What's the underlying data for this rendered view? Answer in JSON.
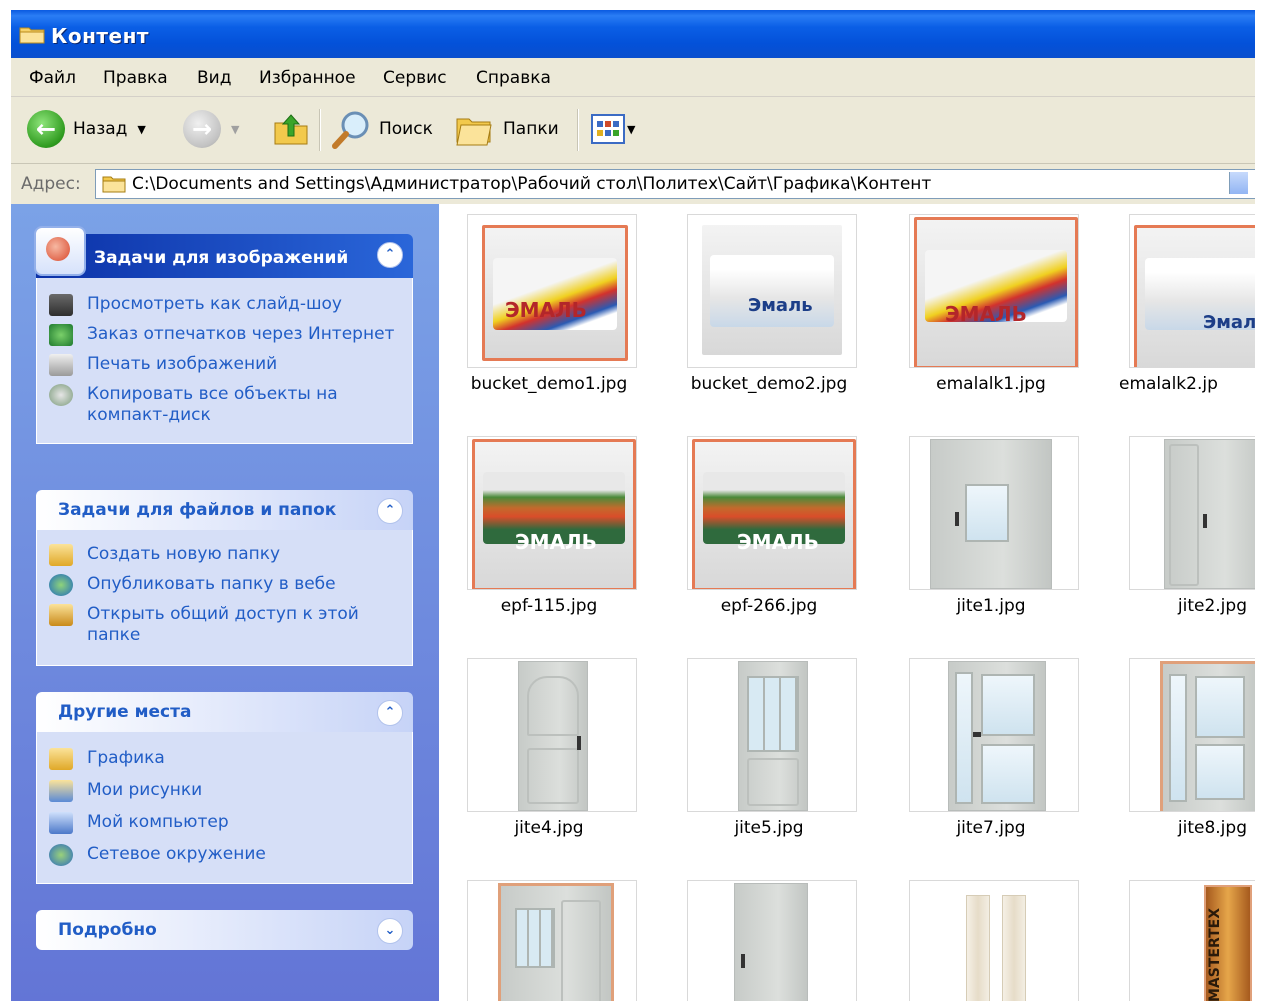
{
  "window": {
    "title": "Контент"
  },
  "menu": [
    "Файл",
    "Правка",
    "Вид",
    "Избранное",
    "Сервис",
    "Справка"
  ],
  "toolbar": {
    "back_label": "Назад",
    "search_label": "Поиск",
    "folders_label": "Папки"
  },
  "address": {
    "label": "Адрес:",
    "path": "C:\\Documents and Settings\\Администратор\\Рабочий стол\\Политех\\Сайт\\Графика\\Контент"
  },
  "left_pane": {
    "image_tasks": {
      "title": "Задачи для изображений",
      "items": [
        {
          "label": "Просмотреть как слайд-шоу",
          "icon": "slideshow-icon"
        },
        {
          "label": "Заказ отпечатков через Интернет",
          "icon": "order-prints-icon"
        },
        {
          "label": "Печать изображений",
          "icon": "printer-icon"
        },
        {
          "label": "Копировать все объекты на компакт-диск",
          "icon": "cd-copy-icon"
        }
      ]
    },
    "file_tasks": {
      "title": "Задачи для файлов и папок",
      "items": [
        {
          "label": "Создать новую папку",
          "icon": "new-folder-icon"
        },
        {
          "label": "Опубликовать папку в вебе",
          "icon": "publish-web-icon"
        },
        {
          "label": "Открыть общий доступ к этой папке",
          "icon": "share-folder-icon"
        }
      ]
    },
    "other_places": {
      "title": "Другие места",
      "items": [
        {
          "label": "Графика",
          "icon": "folder-icon"
        },
        {
          "label": "Мои рисунки",
          "icon": "my-pictures-icon"
        },
        {
          "label": "Мой компьютер",
          "icon": "my-computer-icon"
        },
        {
          "label": "Сетевое окружение",
          "icon": "network-icon"
        }
      ]
    },
    "details": {
      "title": "Подробно"
    }
  },
  "files": [
    {
      "name": "bucket_demo1.jpg",
      "kind": "paint-can"
    },
    {
      "name": "bucket_demo2.jpg",
      "kind": "paint-bucket"
    },
    {
      "name": "emalalk1.jpg",
      "kind": "paint-can"
    },
    {
      "name": "emalalk2.jp",
      "kind": "paint-bucket"
    },
    {
      "name": "epf-115.jpg",
      "kind": "paint-can-green"
    },
    {
      "name": "epf-266.jpg",
      "kind": "paint-can-green"
    },
    {
      "name": "jite1.jpg",
      "kind": "door"
    },
    {
      "name": "jite2.jpg",
      "kind": "door"
    },
    {
      "name": "jite4.jpg",
      "kind": "door"
    },
    {
      "name": "jite5.jpg",
      "kind": "door"
    },
    {
      "name": "jite7.jpg",
      "kind": "door"
    },
    {
      "name": "jite8.jpg",
      "kind": "door"
    },
    {
      "name": "",
      "kind": "door"
    },
    {
      "name": "",
      "kind": "door"
    },
    {
      "name": "",
      "kind": "sealant-tubes"
    },
    {
      "name": "",
      "kind": "sealant-tube"
    }
  ],
  "thumb_text": {
    "emal": "ЭМАЛЬ",
    "emal_mixed": "Эмаль",
    "mastertex": "MASTERTEX"
  },
  "colors": {
    "titlebar": "#0a5ae0",
    "left_pane": "#6f8ee0",
    "task_text": "#215dc6",
    "chrome": "#ece9d8"
  }
}
